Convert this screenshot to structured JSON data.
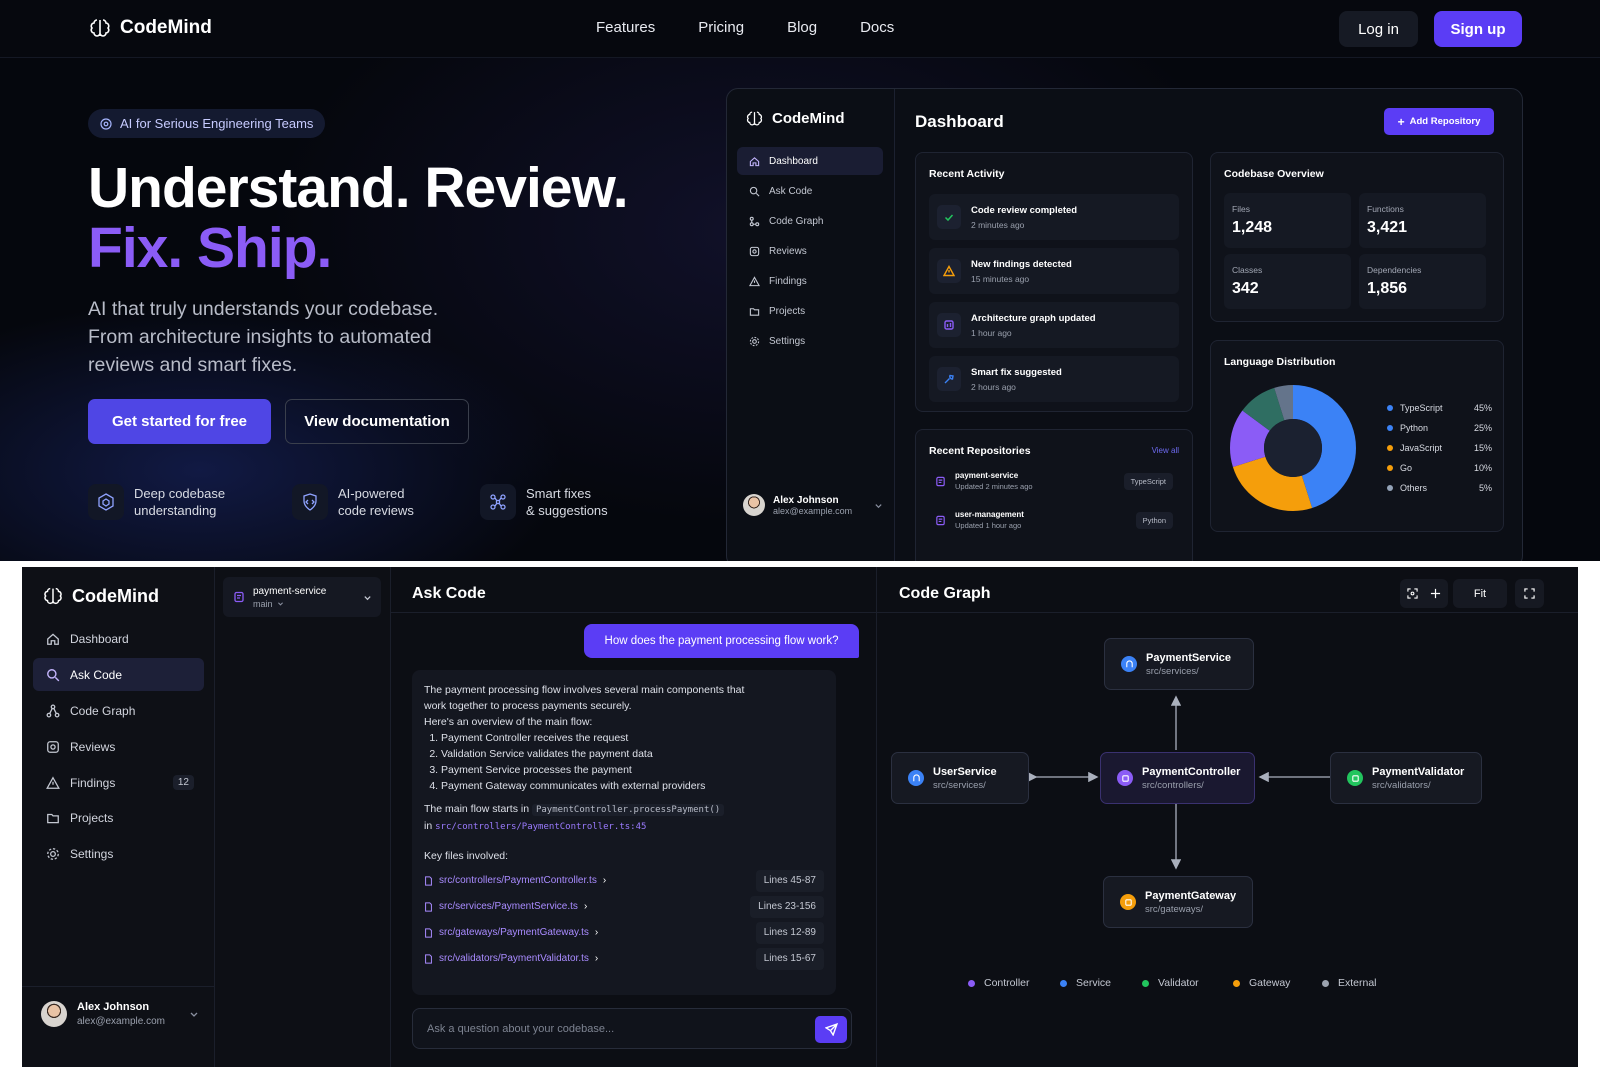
{
  "hero": {
    "nav": {
      "brand": "CodeMind",
      "links": [
        "Features",
        "Pricing",
        "Blog",
        "Docs"
      ],
      "login": "Log in",
      "signup": "Sign up"
    },
    "pill": "AI for Serious Engineering Teams",
    "headline_1": "Understand. Review.",
    "headline_2": "Fix. Ship.",
    "subtitle": "AI that truly understands your codebase. From architecture insights to automated reviews and smart fixes.",
    "cta_primary": "Get started for free",
    "cta_secondary": "View documentation",
    "features": [
      {
        "line1": "Deep codebase",
        "line2": "understanding",
        "icon": "cube-icon"
      },
      {
        "line1": "AI-powered",
        "line2": "code reviews",
        "icon": "shield-code-icon"
      },
      {
        "line1": "Smart fixes",
        "line2": "& suggestions",
        "icon": "nodes-icon"
      }
    ]
  },
  "dashboard": {
    "brand": "CodeMind",
    "nav": [
      "Dashboard",
      "Ask Code",
      "Code Graph",
      "Reviews",
      "Findings",
      "Projects",
      "Settings"
    ],
    "active": "Dashboard",
    "title": "Dashboard",
    "add_repo": "Add Repository",
    "recent_activity_title": "Recent Activity",
    "activity": [
      {
        "title": "Code review completed",
        "time": "2 minutes ago",
        "icon": "check-icon",
        "color": "#22c55e"
      },
      {
        "title": "New findings detected",
        "time": "15 minutes ago",
        "icon": "warning-icon",
        "color": "#f59e0b"
      },
      {
        "title": "Architecture graph updated",
        "time": "1 hour ago",
        "icon": "graph-icon",
        "color": "#8b5cf6"
      },
      {
        "title": "Smart fix suggested",
        "time": "2 hours ago",
        "icon": "wrench-icon",
        "color": "#3b82f6"
      }
    ],
    "overview_title": "Codebase Overview",
    "stats": [
      {
        "label": "Files",
        "value": "1,248"
      },
      {
        "label": "Functions",
        "value": "3,421"
      },
      {
        "label": "Classes",
        "value": "342"
      },
      {
        "label": "Dependencies",
        "value": "1,856"
      }
    ],
    "lang_title": "Language Distribution",
    "languages": [
      {
        "name": "TypeScript",
        "pct": "45%",
        "value": 45,
        "color": "#3b82f6"
      },
      {
        "name": "Python",
        "pct": "25%",
        "value": 25,
        "color": "#f59e0b"
      },
      {
        "name": "JavaScript",
        "pct": "15%",
        "value": 15,
        "color": "#8b5cf6"
      },
      {
        "name": "Go",
        "pct": "10%",
        "value": 10,
        "color": "#2f6e62"
      },
      {
        "name": "Others",
        "pct": "5%",
        "value": 5,
        "color": "#64748b"
      }
    ],
    "repos_title": "Recent Repositories",
    "view_all": "View all",
    "repos": [
      {
        "name": "payment-service",
        "updated": "Updated 2 minutes ago",
        "lang": "TypeScript"
      },
      {
        "name": "user-management",
        "updated": "Updated 1 hour ago",
        "lang": "Python"
      }
    ],
    "user": {
      "name": "Alex Johnson",
      "email": "alex@example.com"
    }
  },
  "app": {
    "brand": "CodeMind",
    "nav": [
      {
        "label": "Dashboard",
        "icon": "home-icon"
      },
      {
        "label": "Ask Code",
        "icon": "search-icon"
      },
      {
        "label": "Code Graph",
        "icon": "graph-icon"
      },
      {
        "label": "Reviews",
        "icon": "review-icon"
      },
      {
        "label": "Findings",
        "icon": "warning-icon",
        "badge": "12"
      },
      {
        "label": "Projects",
        "icon": "folder-icon"
      },
      {
        "label": "Settings",
        "icon": "gear-icon"
      }
    ],
    "active": "Ask Code",
    "repo": {
      "name": "payment-service",
      "branch": "main"
    },
    "user": {
      "name": "Alex Johnson",
      "email": "alex@example.com"
    },
    "ask": {
      "title": "Ask Code",
      "question": "How does the payment processing flow work?",
      "answer_intro": "The payment processing flow involves several main components that work together to process payments securely.",
      "overview_line": "Here's an overview of the main flow:",
      "steps": [
        "Payment Controller receives the request",
        "Validation Service validates the payment data",
        "Payment Service processes the payment",
        "Payment Gateway communicates with external providers"
      ],
      "flow_start_text": "The main flow starts in",
      "flow_start_code": "PaymentController.processPayment()",
      "flow_in": "in",
      "flow_path": "src/controllers/PaymentController.ts:45",
      "key_files_title": "Key files involved:",
      "files": [
        {
          "path": "src/controllers/PaymentController.ts",
          "lines": "Lines 45-87"
        },
        {
          "path": "src/services/PaymentService.ts",
          "lines": "Lines 23-156"
        },
        {
          "path": "src/gateways/PaymentGateway.ts",
          "lines": "Lines 12-89"
        },
        {
          "path": "src/validators/PaymentValidator.ts",
          "lines": "Lines 15-67"
        }
      ],
      "placeholder": "Ask a question about your codebase..."
    },
    "graph": {
      "title": "Code Graph",
      "fit": "Fit",
      "nodes": [
        {
          "name": "PaymentService",
          "path": "src/services/",
          "type": "Service"
        },
        {
          "name": "UserService",
          "path": "src/services/",
          "type": "Service"
        },
        {
          "name": "PaymentController",
          "path": "src/controllers/",
          "type": "Controller"
        },
        {
          "name": "PaymentValidator",
          "path": "src/validators/",
          "type": "Validator"
        },
        {
          "name": "PaymentGateway",
          "path": "src/gateways/",
          "type": "Gateway"
        }
      ],
      "legend": [
        {
          "label": "Controller",
          "color": "#8b5cf6"
        },
        {
          "label": "Service",
          "color": "#3b82f6"
        },
        {
          "label": "Validator",
          "color": "#22c55e"
        },
        {
          "label": "Gateway",
          "color": "#f59e0b"
        },
        {
          "label": "External",
          "color": "#9ca3af"
        }
      ]
    }
  }
}
